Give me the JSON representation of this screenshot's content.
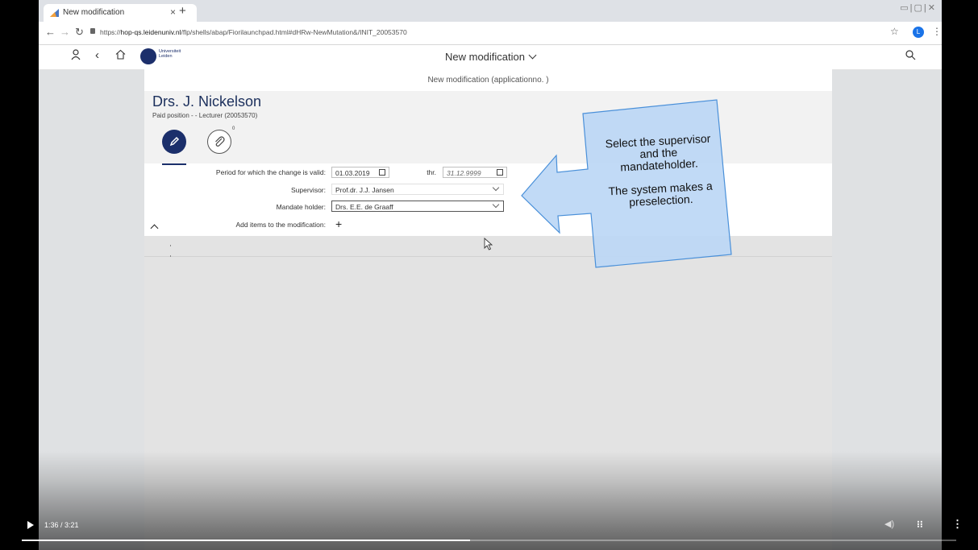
{
  "browser": {
    "tab_title": "New modification",
    "tab_close": "×",
    "new_tab": "+",
    "url_prefix": "https://",
    "url_host": "hop-qs.leidenuniv.nl",
    "url_path": "/flp/shells/abap/Fiorilaunchpad.html#dHRw-NewMutation&/INIT_20053570",
    "profile_initial": "L"
  },
  "shell": {
    "logo_text_line1": "Universiteit",
    "logo_text_line2": "Leiden",
    "title": "New modification"
  },
  "page": {
    "subtitle": "New modification (applicationno. )",
    "employee_name": "Drs. J. Nickelson",
    "employee_position": "Paid position - - Lecturer (20053570)",
    "attachment_count": "0"
  },
  "form": {
    "period_label": "Period for which the change is valid:",
    "period_from": "01.03.2019",
    "thr_label": "thr.",
    "period_to": "31.12.9999",
    "supervisor_label": "Supervisor:",
    "supervisor_value": "Prof.dr. J.J. Jansen",
    "mandate_label": "Mandate holder:",
    "mandate_value": "Drs. E.E. de Graaff",
    "add_items_label": "Add items to the modification:"
  },
  "callout": {
    "line1": "Select the supervisor",
    "line2": "and the",
    "line3": "mandateholder.",
    "line4": "The system makes a",
    "line5": "preselection."
  },
  "video": {
    "time": "1:36 / 3:21",
    "progress": 0.48
  },
  "colors": {
    "brand": "#1b2f6b",
    "callout_fill": "#bcd7f5",
    "callout_stroke": "#4a90d9"
  }
}
